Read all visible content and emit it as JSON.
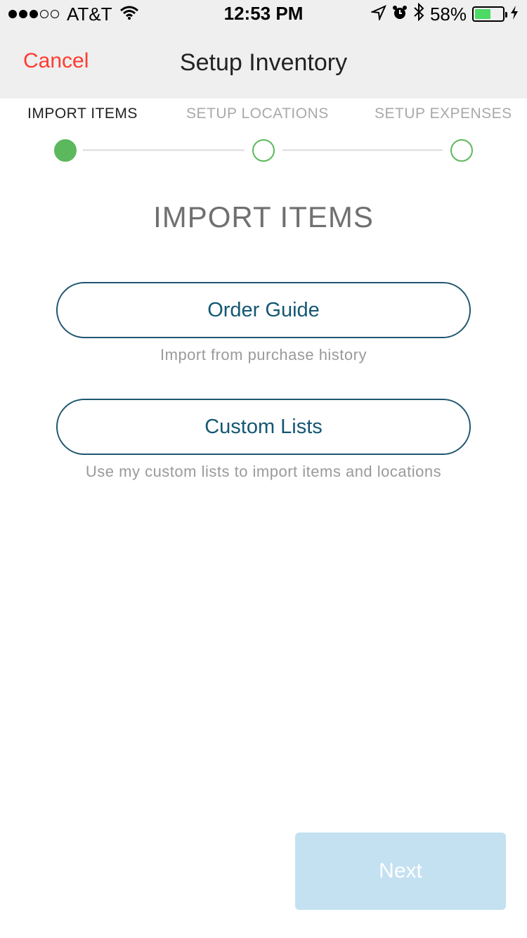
{
  "status_bar": {
    "carrier": "AT&T",
    "signal_bars_filled": 3,
    "signal_bars_total": 5,
    "time": "12:53 PM",
    "battery_percent_text": "58%",
    "battery_level": 0.58,
    "icons": [
      "wifi-icon",
      "location-arrow-icon",
      "alarm-icon",
      "bluetooth-icon",
      "charging-bolt-icon"
    ]
  },
  "nav": {
    "cancel_label": "Cancel",
    "title": "Setup Inventory"
  },
  "stepper": {
    "steps": [
      {
        "label": "IMPORT ITEMS",
        "state": "current"
      },
      {
        "label": "SETUP LOCATIONS",
        "state": "pending"
      },
      {
        "label": "SETUP EXPENSES",
        "state": "pending"
      }
    ]
  },
  "main": {
    "section_title": "IMPORT ITEMS",
    "options": [
      {
        "label": "Order Guide",
        "caption": "Import from purchase history"
      },
      {
        "label": "Custom Lists",
        "caption": "Use my custom lists to import items and locations"
      }
    ]
  },
  "footer": {
    "next_label": "Next"
  },
  "colors": {
    "cancel": "#ff3b30",
    "accent_green": "#5cb85c",
    "button_border": "#1f5670",
    "button_text": "#145774",
    "next_disabled_bg": "#c4e1f1",
    "header_bg": "#efefef"
  }
}
